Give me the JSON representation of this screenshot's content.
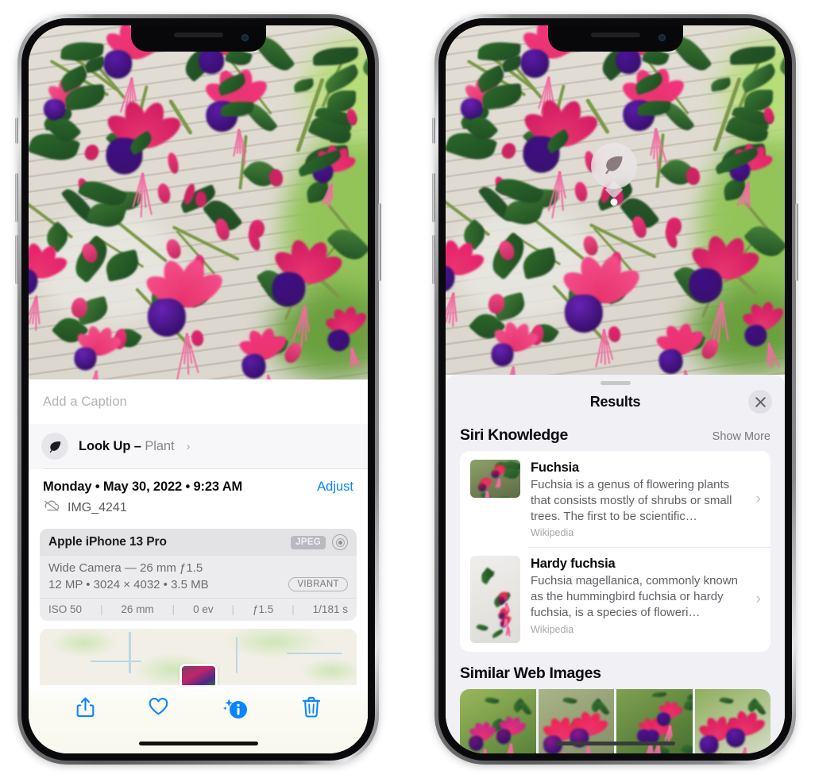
{
  "left_phone": {
    "caption": {
      "placeholder": "Add a Caption"
    },
    "lookup": {
      "label": "Look Up – ",
      "subject": "Plant",
      "chevron": "›",
      "icon": "leaf-icon"
    },
    "metadata": {
      "date": "Monday • May 30, 2022 • 9:23 AM",
      "adjust_label": "Adjust",
      "filename": "IMG_4241",
      "cloud_icon": "cloud-slash-icon"
    },
    "exif": {
      "device": "Apple iPhone 13 Pro",
      "format_tag": "JPEG",
      "lens": "Wide Camera — 26 mm ƒ1.5",
      "size_line": "12 MP • 3024 × 4032 • 3.5 MB",
      "style_tag": "VIBRANT",
      "stats": [
        "ISO 50",
        "26 mm",
        "0 ev",
        "ƒ1.5",
        "1/181 s"
      ]
    },
    "toolbar": [
      {
        "name": "share-button",
        "icon": "share-icon"
      },
      {
        "name": "favorite-button",
        "icon": "heart-icon"
      },
      {
        "name": "info-button",
        "icon": "info-sparkle-icon"
      },
      {
        "name": "delete-button",
        "icon": "trash-icon"
      }
    ]
  },
  "right_phone": {
    "lookup_pin": {
      "icon": "leaf-icon"
    },
    "panel": {
      "title": "Results",
      "close_icon": "close-icon",
      "sections": [
        {
          "title": "Siri Knowledge",
          "action": "Show More",
          "cards": [
            {
              "title": "Fuchsia",
              "desc": "Fuchsia is a genus of flowering plants that consists mostly of shrubs or small trees. The first to be scientific…",
              "source": "Wikipedia",
              "chevron": "›"
            },
            {
              "title": "Hardy fuchsia",
              "desc": "Fuchsia magellanica, commonly known as the hummingbird fuchsia or hardy fuchsia, is a species of floweri…",
              "source": "Wikipedia",
              "chevron": "›"
            }
          ]
        },
        {
          "title": "Similar Web Images",
          "images": 4
        }
      ]
    }
  },
  "colors": {
    "accent_blue": "#0a84ff",
    "panel_bg": "#f0f0f5",
    "card_bg": "#ffffff",
    "exif_bg": "#ececee",
    "secondary_text": "#5f5f66"
  }
}
